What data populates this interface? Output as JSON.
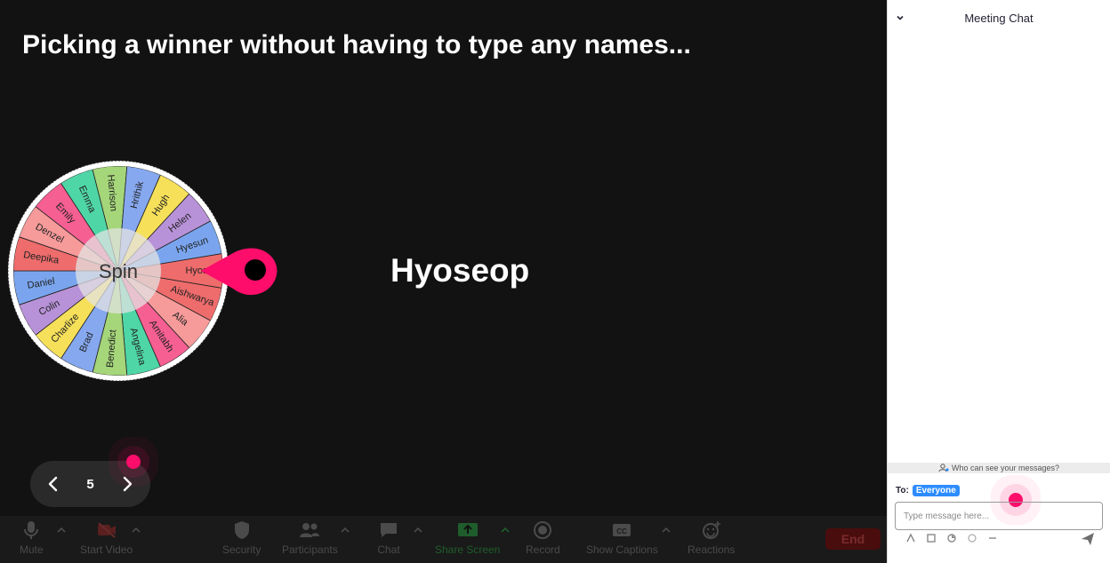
{
  "slide": {
    "title": "Picking a winner without having to type any names...",
    "winner": "Hyoseop"
  },
  "wheel": {
    "center_label": "Spin",
    "segments": [
      {
        "name": "Hyoseop",
        "label": "Hyos",
        "color": "#ef6c6c"
      },
      {
        "name": "Aishwarya",
        "label": "Aishwarya",
        "color": "#ef6c6c"
      },
      {
        "name": "Alia",
        "label": "Alia",
        "color": "#f79a9a"
      },
      {
        "name": "Amitabh",
        "label": "Amitabh",
        "color": "#f65f92"
      },
      {
        "name": "Angelina",
        "label": "Angelina",
        "color": "#4fd6a7"
      },
      {
        "name": "Benedict",
        "label": "Benedict",
        "color": "#a5d67a"
      },
      {
        "name": "Brad",
        "label": "Brad",
        "color": "#86a8ef"
      },
      {
        "name": "Charlize",
        "label": "Charlize",
        "color": "#f6e05a"
      },
      {
        "name": "Colin",
        "label": "Colin",
        "color": "#b892d8"
      },
      {
        "name": "Daniel",
        "label": "Daniel",
        "color": "#7aa5ee"
      },
      {
        "name": "Deepika",
        "label": "Deepika",
        "color": "#ef6c6c"
      },
      {
        "name": "Denzel",
        "label": "Denzel",
        "color": "#f79a9a"
      },
      {
        "name": "Emily",
        "label": "Emily",
        "color": "#f65f92"
      },
      {
        "name": "Emma",
        "label": "Emma",
        "color": "#4fd6a7"
      },
      {
        "name": "Harrison",
        "label": "Harrison",
        "color": "#a5d67a"
      },
      {
        "name": "Hrithik",
        "label": "Hrithik",
        "color": "#86a8ef"
      },
      {
        "name": "Hugh",
        "label": "Hugh",
        "color": "#f6e05a"
      },
      {
        "name": "Helen",
        "label": "Helen",
        "color": "#b892d8"
      },
      {
        "name": "Hyesun",
        "label": "Hyesun",
        "color": "#7aa5ee"
      }
    ],
    "pointer_color": "#ff0d6b"
  },
  "pager": {
    "page": "5"
  },
  "toolbar": {
    "mute": "Mute",
    "start_video": "Start Video",
    "security": "Security",
    "participants": "Participants",
    "chat": "Chat",
    "share_screen": "Share Screen",
    "record": "Record",
    "show_captions": "Show Captions",
    "reactions": "Reactions",
    "end": "End"
  },
  "chat": {
    "title": "Meeting Chat",
    "visibility_note": "Who can see your messages?",
    "to_label": "To:",
    "recipient": "Everyone",
    "input_placeholder": "Type message here..."
  },
  "colors": {
    "stage_bg": "#121212",
    "accent_pink": "#ff0d6b",
    "chip_blue": "#2d8cff",
    "share_green": "#1f5d2c",
    "end_red": "#4a0d0d"
  }
}
